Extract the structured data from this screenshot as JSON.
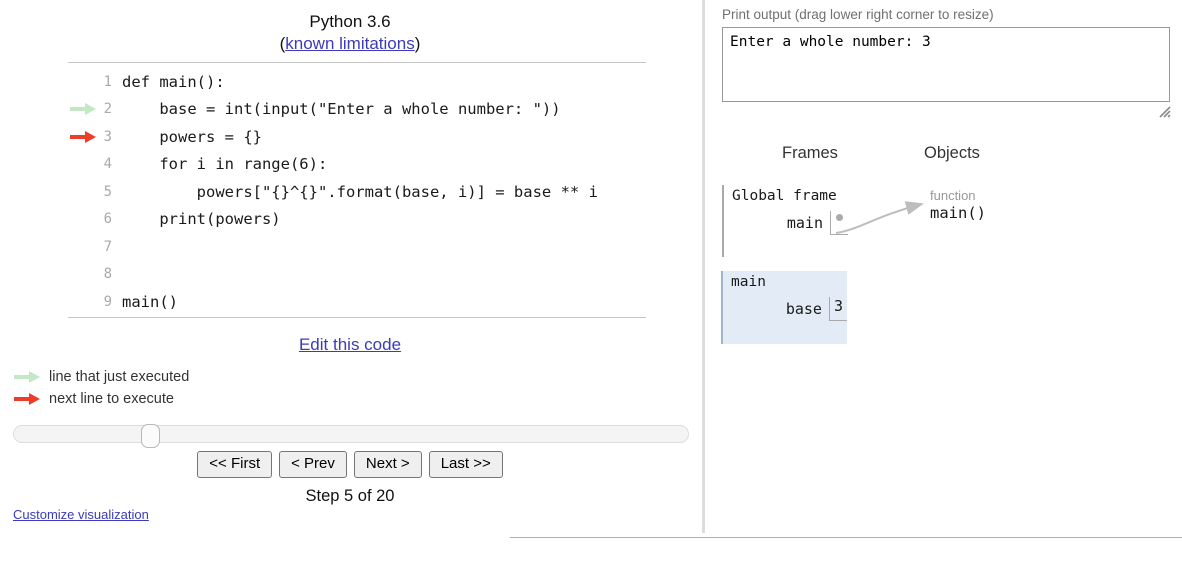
{
  "meta": {
    "python_version_label": "Python 3.6",
    "known_limitations_label": "known limitations",
    "paren_open": "(",
    "paren_close": ")"
  },
  "code": {
    "lines": [
      {
        "n": "1",
        "text": "def main():",
        "arrow": "none"
      },
      {
        "n": "2",
        "text": "    base = int(input(\"Enter a whole number: \"))",
        "arrow": "green"
      },
      {
        "n": "3",
        "text": "    powers = {}",
        "arrow": "red"
      },
      {
        "n": "4",
        "text": "    for i in range(6):",
        "arrow": "none"
      },
      {
        "n": "5",
        "text": "        powers[\"{}^{}\".format(base, i)] = base ** i",
        "arrow": "none"
      },
      {
        "n": "6",
        "text": "    print(powers)",
        "arrow": "none"
      },
      {
        "n": "7",
        "text": "",
        "arrow": "none"
      },
      {
        "n": "8",
        "text": "",
        "arrow": "none"
      },
      {
        "n": "9",
        "text": "main()",
        "arrow": "none"
      }
    ],
    "edit_this_code_label": "Edit this code"
  },
  "legend": {
    "just_executed_label": "line that just executed",
    "next_line_label": "next line to execute",
    "green_color": "#c3e8c3",
    "red_color": "#ed3d29"
  },
  "controls": {
    "first_label": "<< First",
    "prev_label": "< Prev",
    "next_label": "Next >",
    "last_label": "Last >>",
    "step_label": "Step 5 of 20",
    "step_current": 5,
    "step_total": 20,
    "customize_label": "Customize visualization"
  },
  "output": {
    "label": "Print output (drag lower right corner to resize)",
    "text": "Enter a whole number: 3"
  },
  "visualization": {
    "frames_header": "Frames",
    "objects_header": "Objects",
    "global_frame": {
      "title": "Global frame",
      "variables": [
        {
          "name": "main",
          "value": "",
          "is_pointer": true
        }
      ]
    },
    "local_frames": [
      {
        "title": "main",
        "variables": [
          {
            "name": "base",
            "value": "3",
            "is_pointer": false
          }
        ],
        "bg_color": "#e2ebf6"
      }
    ],
    "heap_objects": [
      {
        "type_label": "function",
        "value_label": "main()"
      }
    ]
  }
}
